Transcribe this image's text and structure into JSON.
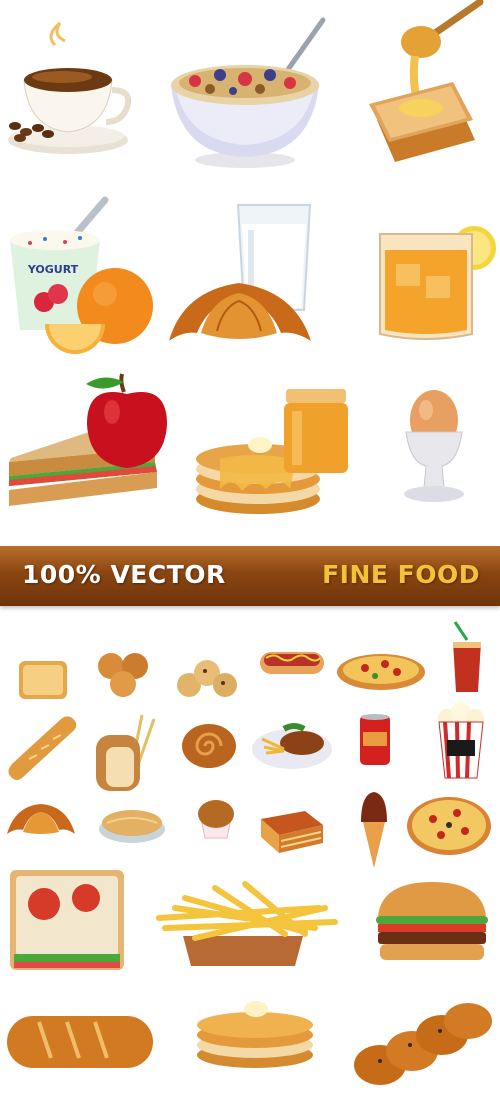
{
  "banner": {
    "left_text": "100% VECTOR",
    "right_text": "FINE FOOD",
    "background": "#8a4511",
    "left_color": "#ffffff",
    "right_color": "#f4c23a"
  },
  "labels": {
    "yogurt": "YOGURT"
  },
  "illustrations": {
    "top_section": [
      "coffee-cup-icon",
      "cereal-bowl-icon",
      "honey-toast-icon",
      "yogurt-cup-icon",
      "orange-icon",
      "milk-glass-icon",
      "croissant-icon",
      "juice-glass-icon",
      "sandwich-icon",
      "apple-icon",
      "pancakes-icon",
      "honey-jar-icon",
      "boiled-egg-icon"
    ],
    "bottom_section": [
      "toast-stack-icon",
      "cookies-icon",
      "cookie-pile-icon",
      "hot-dog-icon",
      "pizza-icon",
      "soda-cup-icon",
      "baguette-icon",
      "bread-loaf-icon",
      "cinnamon-roll-icon",
      "steak-plate-icon",
      "soda-can-icon",
      "popcorn-icon",
      "croissant-small-icon",
      "pie-icon",
      "muffin-icon",
      "lasagna-icon",
      "ice-cream-cone-icon",
      "pizza-whole-icon",
      "club-sandwich-icon",
      "french-fries-icon",
      "hamburger-icon",
      "long-bread-icon",
      "pancake-stack-icon",
      "braided-bread-icon"
    ]
  }
}
